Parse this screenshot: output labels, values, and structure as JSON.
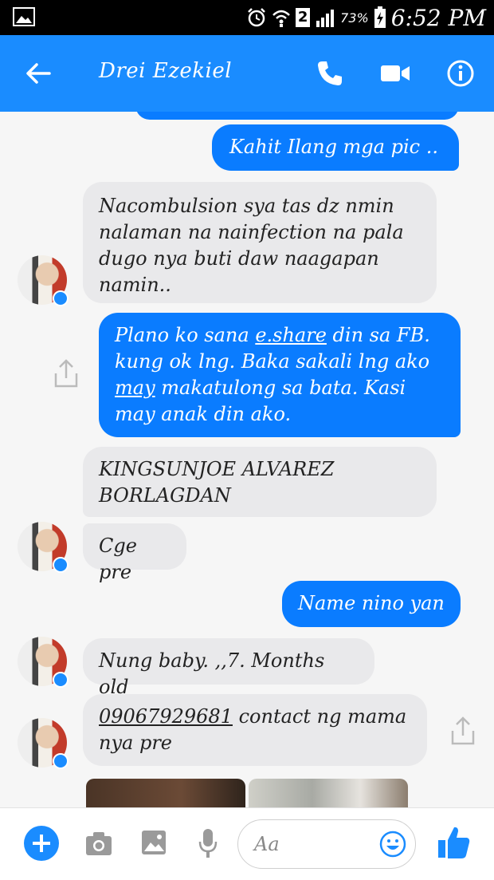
{
  "status_bar": {
    "sim": "2",
    "battery": "73%",
    "time": "6:52 PM"
  },
  "header": {
    "contact_name": "Drei Ezekiel"
  },
  "messages": [
    {
      "from": "me",
      "text": "Kahit Ilang mga pic .."
    },
    {
      "from": "them",
      "text": "Nacombulsion sya tas dz nmin nalaman na nainfection na pala dugo nya buti daw naagapan namin.."
    },
    {
      "from": "me",
      "parts": [
        "Plano ko sana ",
        "e.share",
        " din sa FB. kung ok lng. Baka sakali lng ako ",
        "may",
        " makatulong sa bata. Kasi may anak din ako."
      ]
    },
    {
      "from": "them",
      "text": "KINGSUNJOE ALVAREZ BORLAGDAN"
    },
    {
      "from": "them",
      "text": "Cge pre"
    },
    {
      "from": "me",
      "text": "Name nino yan"
    },
    {
      "from": "them",
      "text": "Nung baby. ,,7. Months old"
    },
    {
      "from": "them",
      "parts": [
        "09067929681",
        " contact ng mama nya pre"
      ]
    }
  ],
  "composer": {
    "placeholder": "Aa"
  },
  "colors": {
    "brand": "#1a8cff",
    "outgoing_bubble": "#0a7cff",
    "incoming_bubble": "#e9e9eb"
  }
}
